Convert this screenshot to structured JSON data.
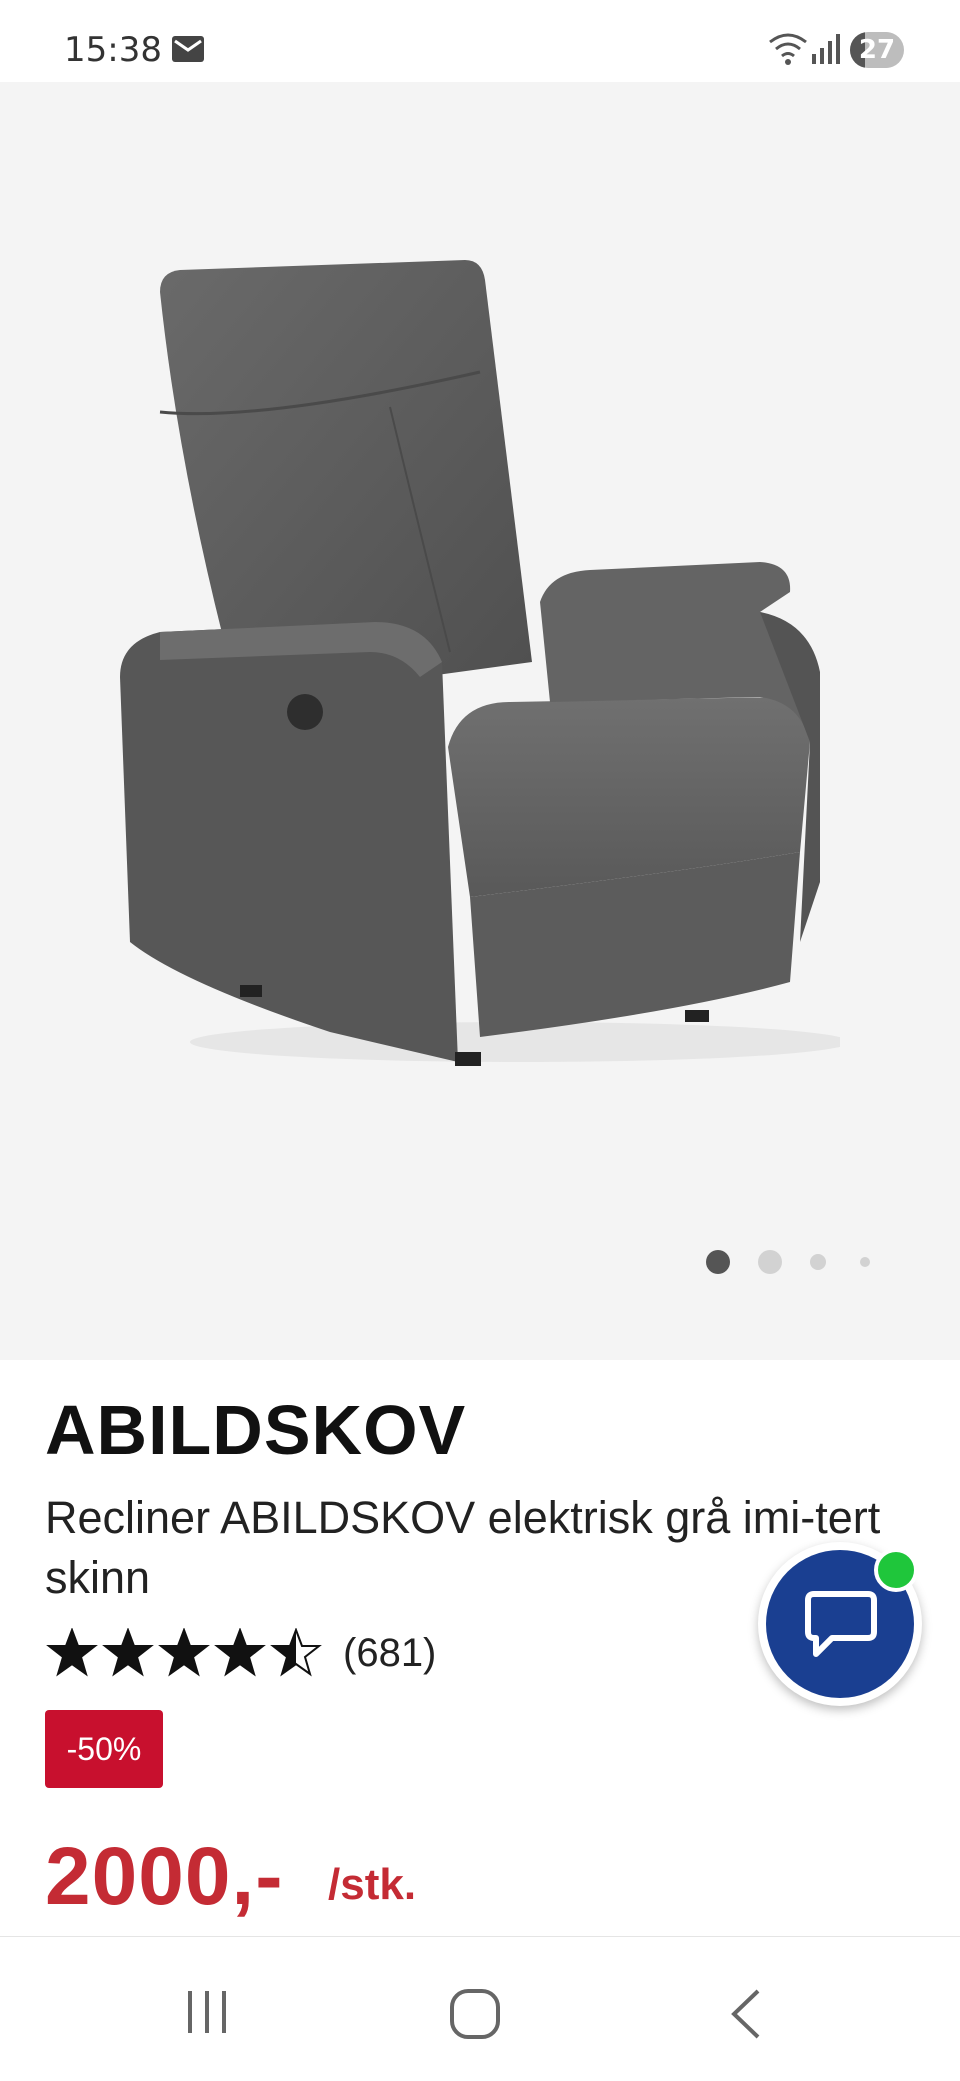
{
  "status_bar": {
    "time": "15:38",
    "battery_level": "27",
    "battery_fraction": 0.27,
    "icons": [
      "mail-icon",
      "wifi-icon",
      "signal-icon",
      "battery-icon"
    ]
  },
  "gallery": {
    "image_count": 4,
    "active_index": 0
  },
  "product": {
    "name": "ABILDSKOV",
    "description": "Recliner ABILDSKOV elektrisk grå imi-tert skinn",
    "rating_value": 4.5,
    "rating_max": 5,
    "rating_count": "(681)",
    "discount": "-50%",
    "price": "2000,-",
    "price_unit": "/stk."
  },
  "colors": {
    "price_red": "#c42b34",
    "badge_red": "#c8102e",
    "chat_blue": "#1a3f91",
    "online_green": "#1fc63b"
  },
  "chat": {
    "icon": "chat-bubble-icon",
    "status": "online"
  },
  "nav": {
    "buttons": [
      "recent-apps-button",
      "home-button",
      "back-button"
    ]
  }
}
